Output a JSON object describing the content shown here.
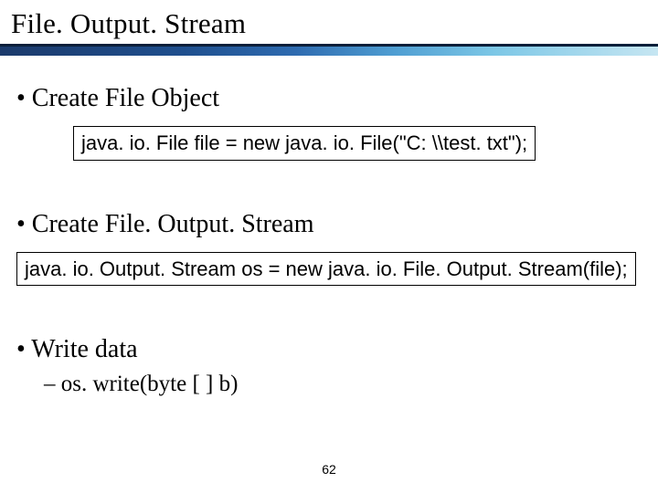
{
  "title": "File. Output. Stream",
  "bullets": {
    "b1": "• Create File Object",
    "code1": "java. io. File file = new java. io. File(\"C: \\\\test. txt\");",
    "b2": "• Create File. Output. Stream",
    "code2": "java. io. Output. Stream os = new java. io. File. Output. Stream(file);",
    "b3": "• Write data",
    "sub3": "– os. write(byte [ ] b)"
  },
  "page_number": "62"
}
